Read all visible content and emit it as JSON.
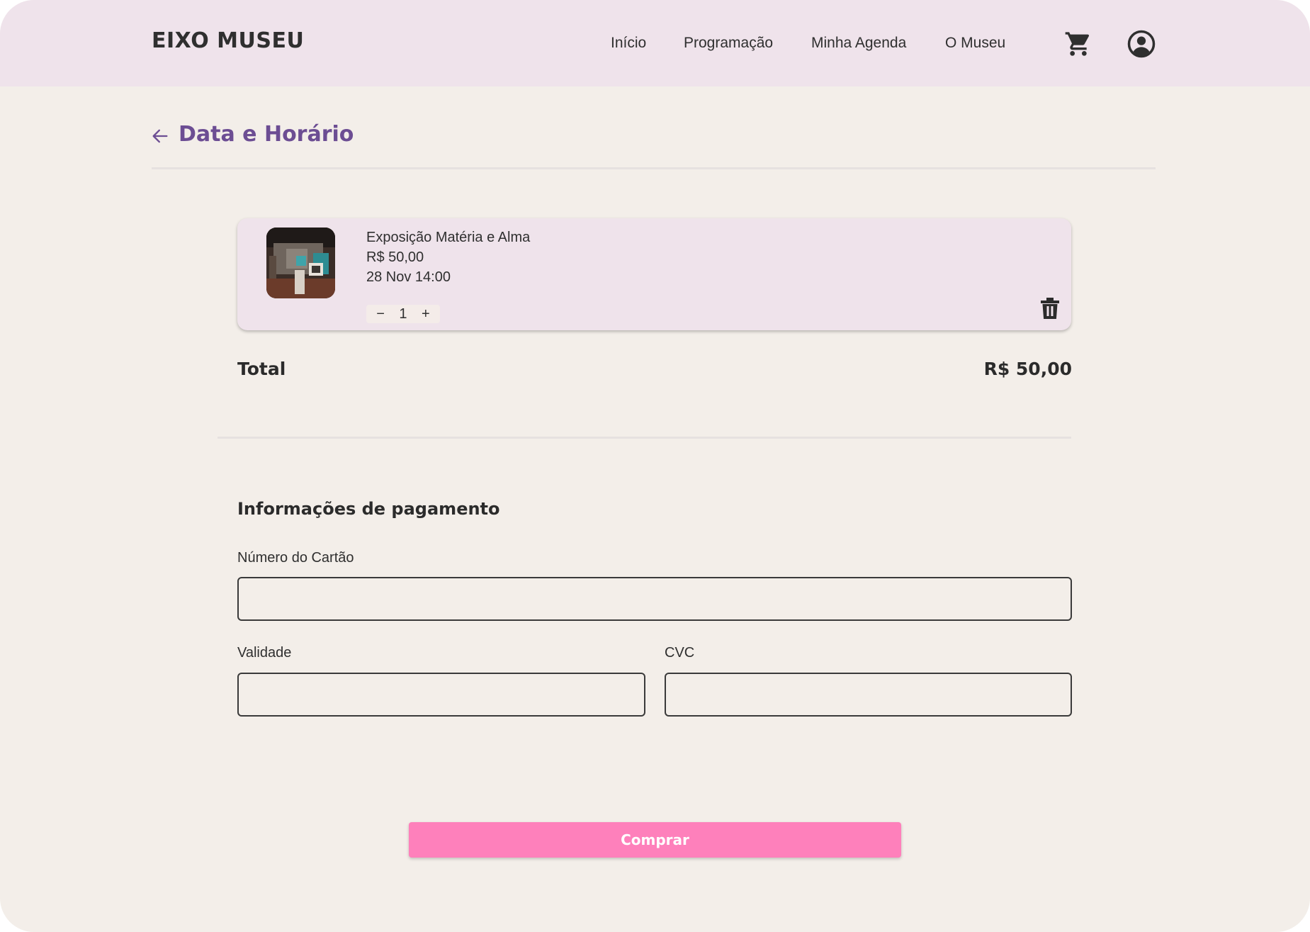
{
  "header": {
    "logo": "EIXO MUSEU",
    "nav": [
      "Início",
      "Programação",
      "Minha Agenda",
      "O Museu"
    ],
    "cart_icon": "cart-icon",
    "account_icon": "account-circle-icon"
  },
  "page": {
    "back_icon": "arrow-left-icon",
    "title": "Data e Horário"
  },
  "cart": {
    "item": {
      "name": "Exposição Matéria e Alma",
      "price": "R$ 50,00",
      "datetime": "28 Nov 14:00",
      "quantity": "1",
      "minus": "−",
      "plus": "+",
      "delete_icon": "trash-icon"
    },
    "total_label": "Total",
    "total_value": "R$ 50,00"
  },
  "payment": {
    "title": "Informações de pagamento",
    "card_number_label": "Número do Cartão",
    "card_number_value": "",
    "validity_label": "Validade",
    "validity_value": "",
    "cvc_label": "CVC",
    "cvc_value": "",
    "submit_label": "Comprar"
  },
  "colors": {
    "background": "#f3eee9",
    "header_bg": "#efe3eb",
    "accent_title": "#6c4d93",
    "button": "#fe80bb"
  }
}
